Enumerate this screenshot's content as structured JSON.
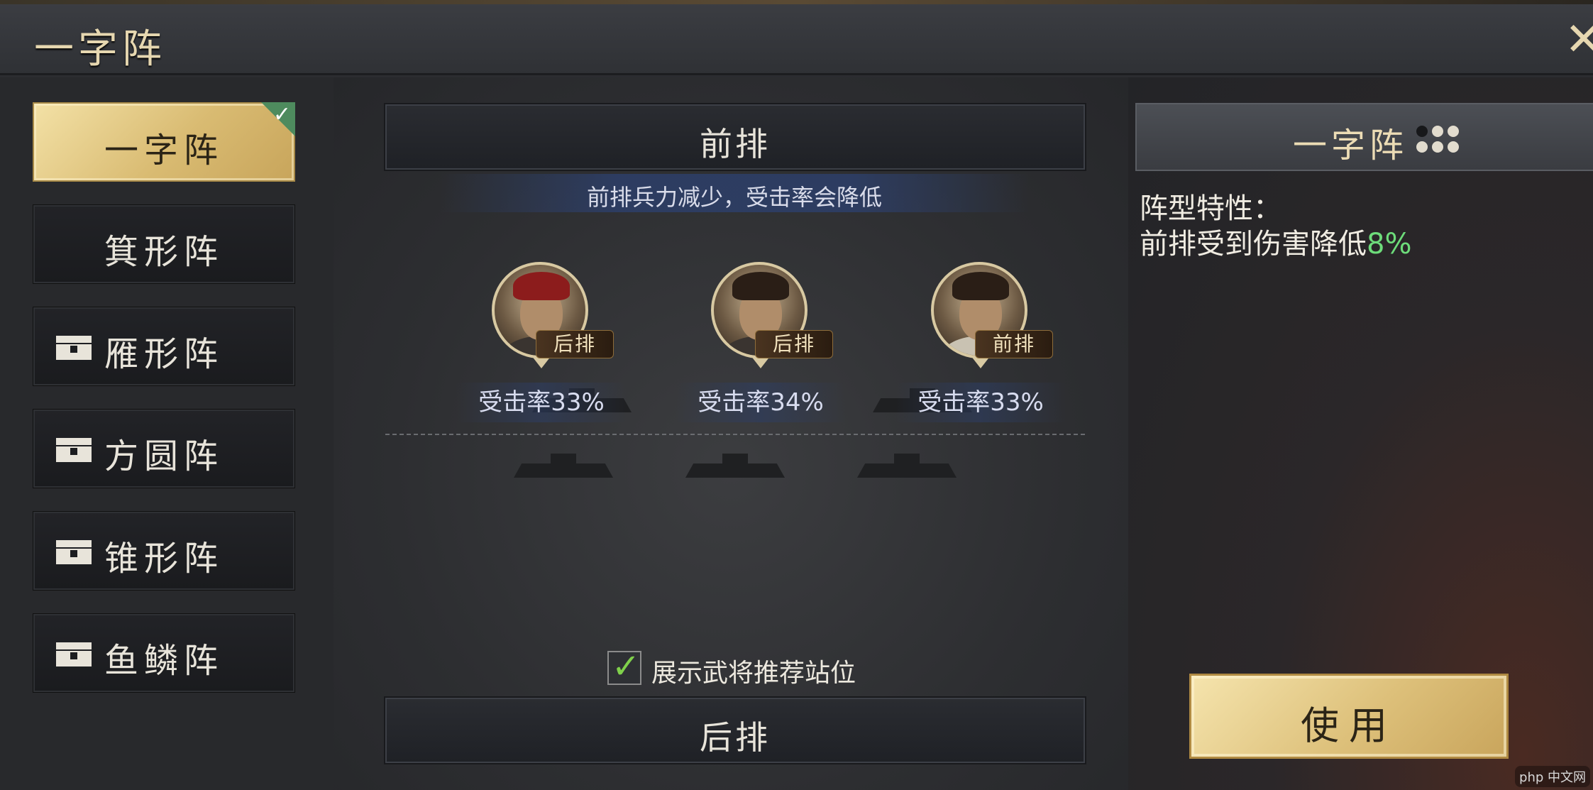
{
  "window": {
    "title": "一字阵"
  },
  "formations": [
    {
      "label": "一字阵",
      "selected": true,
      "locked": false
    },
    {
      "label": "箕形阵",
      "selected": false,
      "locked": false
    },
    {
      "label": "雁形阵",
      "selected": false,
      "locked": true
    },
    {
      "label": "方圆阵",
      "selected": false,
      "locked": true
    },
    {
      "label": "锥形阵",
      "selected": false,
      "locked": true
    },
    {
      "label": "鱼鳞阵",
      "selected": false,
      "locked": true
    }
  ],
  "center": {
    "front_row_label": "前排",
    "front_row_hint": "前排兵力减少，受击率会降低",
    "back_row_label": "后排",
    "heroes": [
      {
        "tag": "后排",
        "hit_rate": "受击率33%"
      },
      {
        "tag": "后排",
        "hit_rate": "受击率34%"
      },
      {
        "tag": "前排",
        "hit_rate": "受击率33%"
      }
    ],
    "show_recommend_label": "展示武将推荐站位",
    "show_recommend_checked": true
  },
  "detail": {
    "name": "一字阵",
    "dots": [
      false,
      true,
      true,
      true,
      true,
      true
    ],
    "prop_title": "阵型特性：",
    "prop_text": "前排受到伤害降低",
    "prop_value": "8%",
    "use_label": "使用"
  },
  "colors": {
    "gold": "#ddc07a",
    "green_value": "#6ddc7a",
    "check_green": "#7fd04b"
  },
  "icons": {
    "close": "close-icon",
    "lock": "lock-chest-icon",
    "check": "check-icon"
  },
  "watermark": "php 中文网"
}
